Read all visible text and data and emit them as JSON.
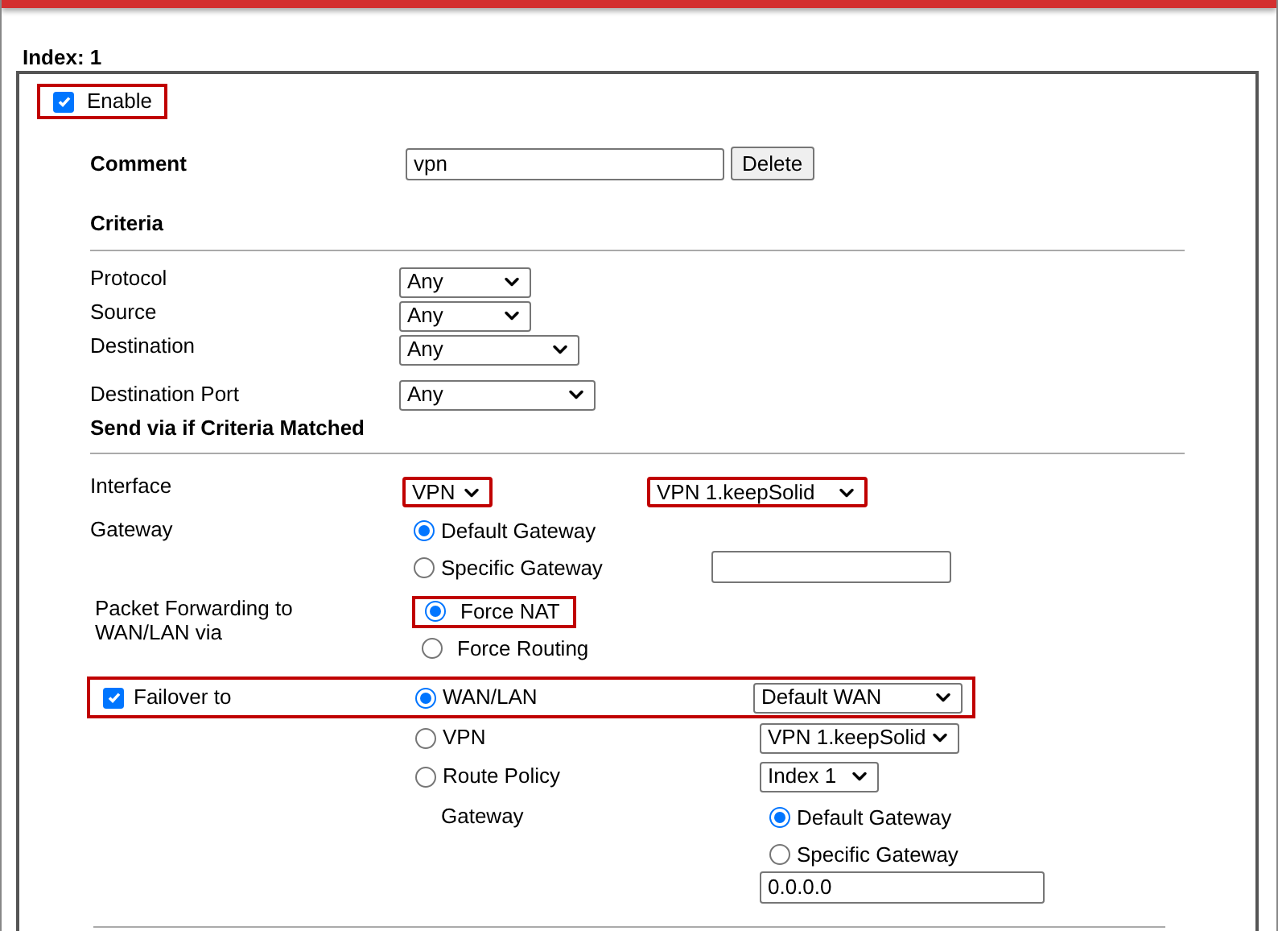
{
  "index_label": "Index: 1",
  "enable": {
    "label": "Enable",
    "checked": true,
    "highlighted": true
  },
  "comment": {
    "label": "Comment",
    "value": "vpn",
    "button": "Delete"
  },
  "criteria": {
    "title": "Criteria",
    "rows": [
      {
        "label": "Protocol",
        "value": "Any"
      },
      {
        "label": "Source",
        "value": "Any"
      },
      {
        "label": "Destination",
        "value": "Any"
      },
      {
        "label": "Destination Port",
        "value": "Any"
      }
    ]
  },
  "send_via": {
    "title": "Send via if Criteria Matched",
    "interface": {
      "label": "Interface",
      "type": {
        "value": "VPN",
        "highlighted": true
      },
      "profile": {
        "value": "VPN 1.keepSolid",
        "highlighted": true
      }
    },
    "gateway": {
      "label": "Gateway",
      "options": [
        {
          "label": "Default Gateway",
          "selected": true
        },
        {
          "label": "Specific Gateway",
          "selected": false
        }
      ]
    },
    "packet_forwarding": {
      "label": "Packet Forwarding to WAN/LAN via",
      "options": [
        {
          "label": "Force NAT",
          "selected": true,
          "highlighted": true
        },
        {
          "label": "Force Routing",
          "selected": false,
          "highlighted": false
        }
      ]
    },
    "failover": {
      "label": "Failover to",
      "checked": true,
      "highlighted": true,
      "options": [
        {
          "label": "WAN/LAN",
          "selected": true,
          "select": "Default WAN"
        },
        {
          "label": "VPN",
          "selected": false,
          "select": "VPN 1.keepSolid"
        },
        {
          "label": "Route Policy",
          "selected": false,
          "select": "Index 1"
        }
      ],
      "gateway": {
        "label": "Gateway",
        "options": [
          {
            "label": "Default Gateway",
            "selected": true
          },
          {
            "label": "Specific Gateway",
            "selected": false
          }
        ],
        "value": "0.0.0.0"
      }
    }
  }
}
